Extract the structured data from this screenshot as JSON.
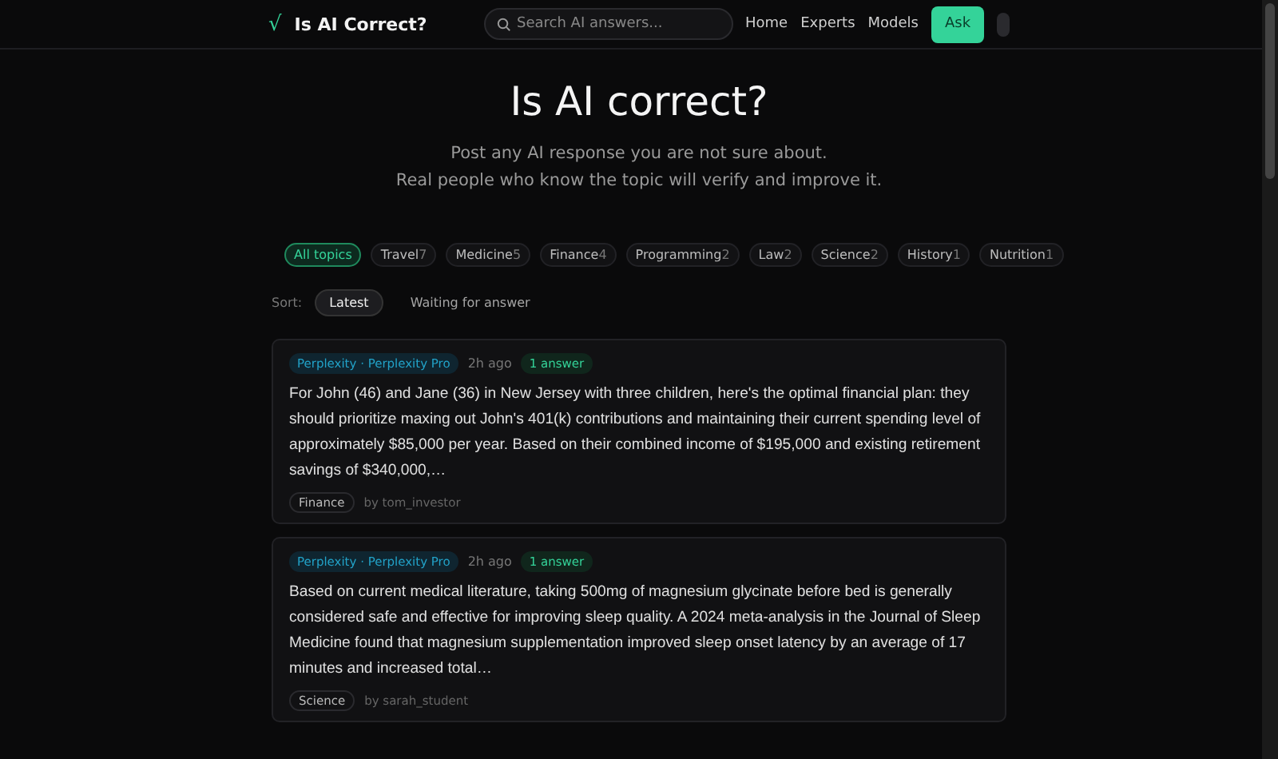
{
  "nav": {
    "logo_mark": "√",
    "brand": "Is AI Correct?",
    "search": {
      "placeholder": "Search AI answers..."
    },
    "links": [
      "Home",
      "Experts",
      "Models"
    ],
    "ask": "Ask"
  },
  "hero": {
    "title": "Is AI correct?",
    "lines": [
      "Post any AI response you are not sure about.",
      "Real people who know the topic will verify and improve it."
    ]
  },
  "topics": [
    {
      "label": "All topics",
      "selected": true
    },
    {
      "label": "Travel",
      "count": "7",
      "selected": false
    },
    {
      "label": "Medicine",
      "count": "5",
      "selected": false
    },
    {
      "label": "Finance",
      "count": "4",
      "selected": false
    },
    {
      "label": "Programming",
      "count": "2",
      "selected": false
    },
    {
      "label": "Law",
      "count": "2",
      "selected": false
    },
    {
      "label": "Science",
      "count": "2",
      "selected": false
    },
    {
      "label": "History",
      "count": "1",
      "selected": false
    },
    {
      "label": "Nutrition",
      "count": "1",
      "selected": false
    }
  ],
  "sort": {
    "label": "Sort:",
    "options": [
      {
        "label": "Latest",
        "selected": true
      },
      {
        "label": "Waiting for answer",
        "selected": false
      }
    ]
  },
  "posts": [
    {
      "model": "Perplexity · Perplexity Pro",
      "time": "2h ago",
      "answers": "1 answer",
      "text": "For John (46) and Jane (36) in New Jersey with three children, here's the optimal financial plan: they should prioritize maxing out John's 401(k) contributions and maintaining their current spending level of approximately $85,000 per year. Based on their combined income of $195,000 and existing retirement savings of $340,000,…",
      "topic": "Finance",
      "author": "by tom_investor"
    },
    {
      "model": "Perplexity · Perplexity Pro",
      "time": "2h ago",
      "answers": "1 answer",
      "text": "Based on current medical literature, taking 500mg of magnesium glycinate before bed is generally considered safe and effective for improving sleep quality. A 2024 meta-analysis in the Journal of Sleep Medicine found that magnesium supplementation improved sleep onset latency by an average of 17 minutes and increased total…",
      "topic": "Science",
      "author": "by sarah_student"
    }
  ]
}
